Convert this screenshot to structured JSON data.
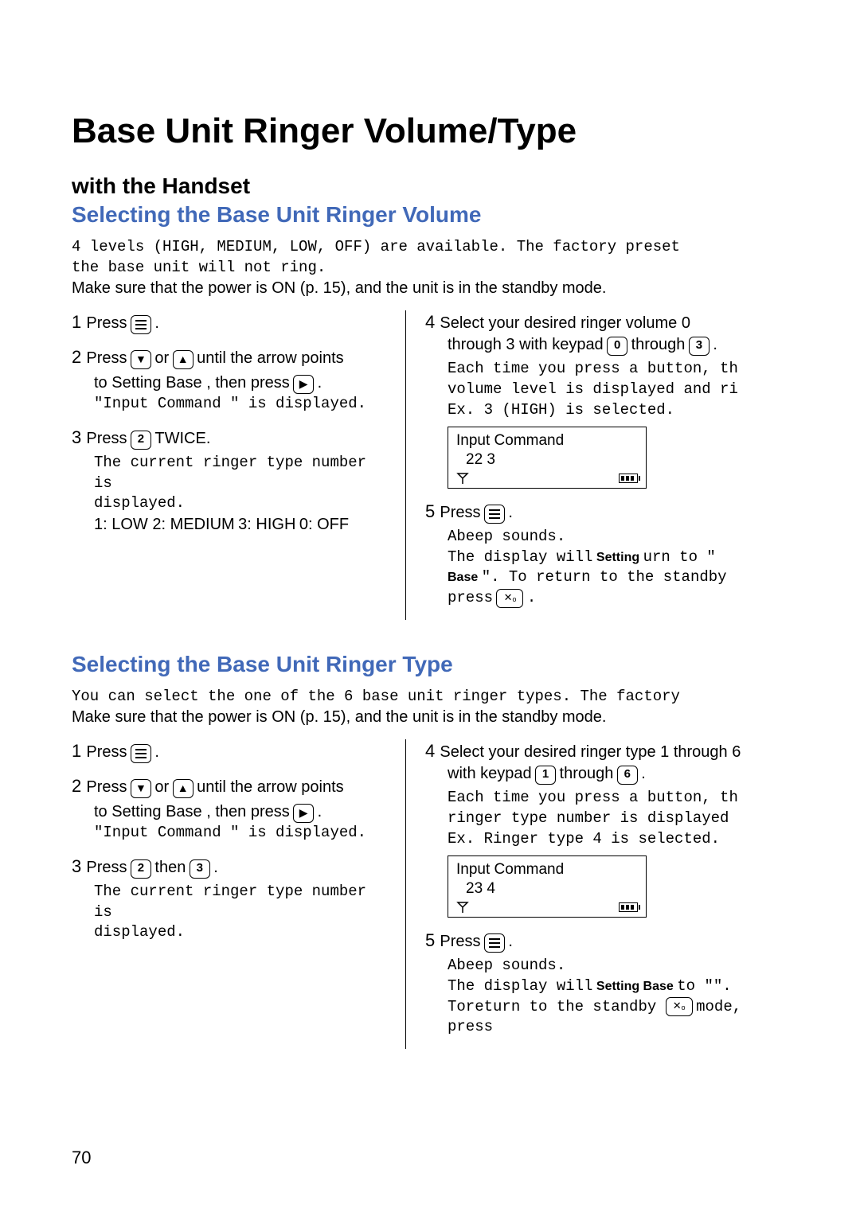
{
  "title": "Base Unit Ringer Volume/Type",
  "section1": {
    "heading_a": "with the Handset",
    "heading_b": "Selecting the Base Unit Ringer Volume",
    "intro_mono": "4 levels (HIGH, MEDIUM, LOW, OFF) are available. The factory preset",
    "intro_mono2": "the base unit will not ring.",
    "intro_sans": "Make sure that the power is ON (p. 15), and the unit is in the standby mode.",
    "step1_prefix": "1 ",
    "step1_text": "Press",
    "step1_suffix": " .",
    "step2_prefix": "2 ",
    "step2_text_a": "Press",
    "step2_text_b": " or",
    "step2_text_c": " until the arrow points",
    "step2_line2a": "to ",
    "step2_setting_base": "\"Setting Base\"",
    "step2_line2b": ", then press",
    "step2_line2c": " .",
    "step2_line3": "\"Input Command \" is displayed.",
    "step3_prefix": "3 ",
    "step3_text_a": "Press",
    "step3_text_b": " TWICE.",
    "step3_body1": "The current ringer type number is",
    "step3_body2": "displayed.",
    "step3_body3a": "1: LOW ",
    "step3_body3b": "2: MEDIUM",
    "step3_body3c": "3: HIGH",
    "step3_body3d": "0: OFF",
    "step4_prefix": "4 ",
    "step4_text_a": "Select your desired ringer volume 0",
    "step4_text_b": "through 3 with keypad",
    "step4_text_c": " through",
    "step4_text_d": " .",
    "step4_body1": "Each time you press a button, th",
    "step4_body2": "volume level is displayed and ri",
    "step4_body3": "Ex. 3 (HIGH) is selected.",
    "lcd1_line1": "Input Command",
    "lcd1_line2": "22  3",
    "step5_prefix": "5 ",
    "step5_text": "Press",
    "step5_suffix": " .",
    "step5_body1": "Abeep sounds.",
    "step5_body2a": "The display will",
    "step5_body2b": "Setting",
    "step5_body2c": "urn to \"",
    "step5_body3a": "Base",
    "step5_body3b": "\". To return to the standby ",
    "step5_body4a": "press",
    "step5_body4b": " ."
  },
  "section2": {
    "heading": "Selecting the Base Unit Ringer Type",
    "intro_mono": "You can select the one of the 6 base unit ringer types. The factory",
    "intro_sans": "Make sure that the power is ON (p. 15), and the unit is in the standby mode.",
    "step1_prefix": "1 ",
    "step1_text": "Press",
    "step1_suffix": " .",
    "step2_prefix": "2 ",
    "step2_text_a": "Press",
    "step2_text_b": " or",
    "step2_text_c": " until the arrow points",
    "step2_line2a": "to ",
    "step2_setting_base": "\"Setting Base\"",
    "step2_line2b": ", then press",
    "step2_line2c": " .",
    "step2_line3": "\"Input Command \" is displayed.",
    "step3_prefix": "3 ",
    "step3_text_a": "Press",
    "step3_text_b": " then",
    "step3_text_c": " .",
    "step3_body1": "The current ringer type number is",
    "step3_body2": "displayed.",
    "step4_prefix": "4 ",
    "step4_text_a": "Select your desired ringer type 1 through 6",
    "step4_text_b": "with keypad",
    "step4_text_c": " through",
    "step4_text_d": " .",
    "step4_body1": "Each time you press a button, th",
    "step4_body2": "ringer type number is displayed",
    "step4_body3": "Ex. Ringer type 4 is selected.",
    "lcd_line1": "Input Command",
    "lcd_line2": "23  4",
    "step5_prefix": "5 ",
    "step5_text": "Press",
    "step5_suffix": " .",
    "step5_body1": "Abeep sounds.",
    "step5_body2a": "The display will",
    "step5_body2b": "Setting Base",
    "step5_body2c": "to \"\".",
    "step5_body3a": "Toreturn to the standby ",
    "step5_body3b": "mode, press"
  },
  "keypad": {
    "k0": "0",
    "k1": "1",
    "k2": "2",
    "k3": "3",
    "k6": "6"
  },
  "page_number": "70"
}
